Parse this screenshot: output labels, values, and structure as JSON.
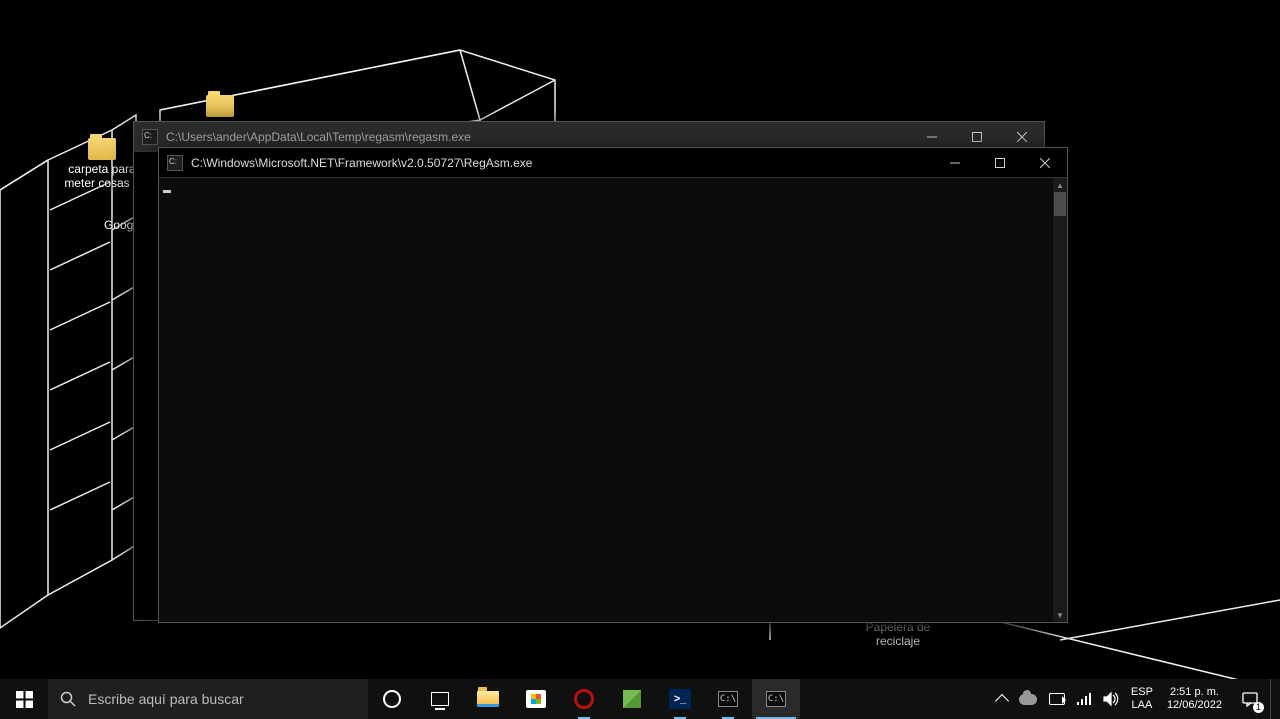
{
  "desktop_icons": {
    "folder1_label": "carpeta para meter cosas d",
    "folder2_label": "",
    "google_label": "Googl",
    "recycle_label_line1": "Papelera de",
    "recycle_label_line2": "reciclaje"
  },
  "window_back": {
    "title": "C:\\Users\\ander\\AppData\\Local\\Temp\\regasm\\regasm.exe"
  },
  "window_front": {
    "title": "C:\\Windows\\Microsoft.NET\\Framework\\v2.0.50727\\RegAsm.exe",
    "body": ""
  },
  "taskbar": {
    "search_placeholder": "Escribe aquí para buscar",
    "ps_label": ">_",
    "lang_top": "ESP",
    "lang_bottom": "LAA",
    "time": "2:51 p. m.",
    "date": "12/06/2022",
    "notif_count": "1"
  }
}
